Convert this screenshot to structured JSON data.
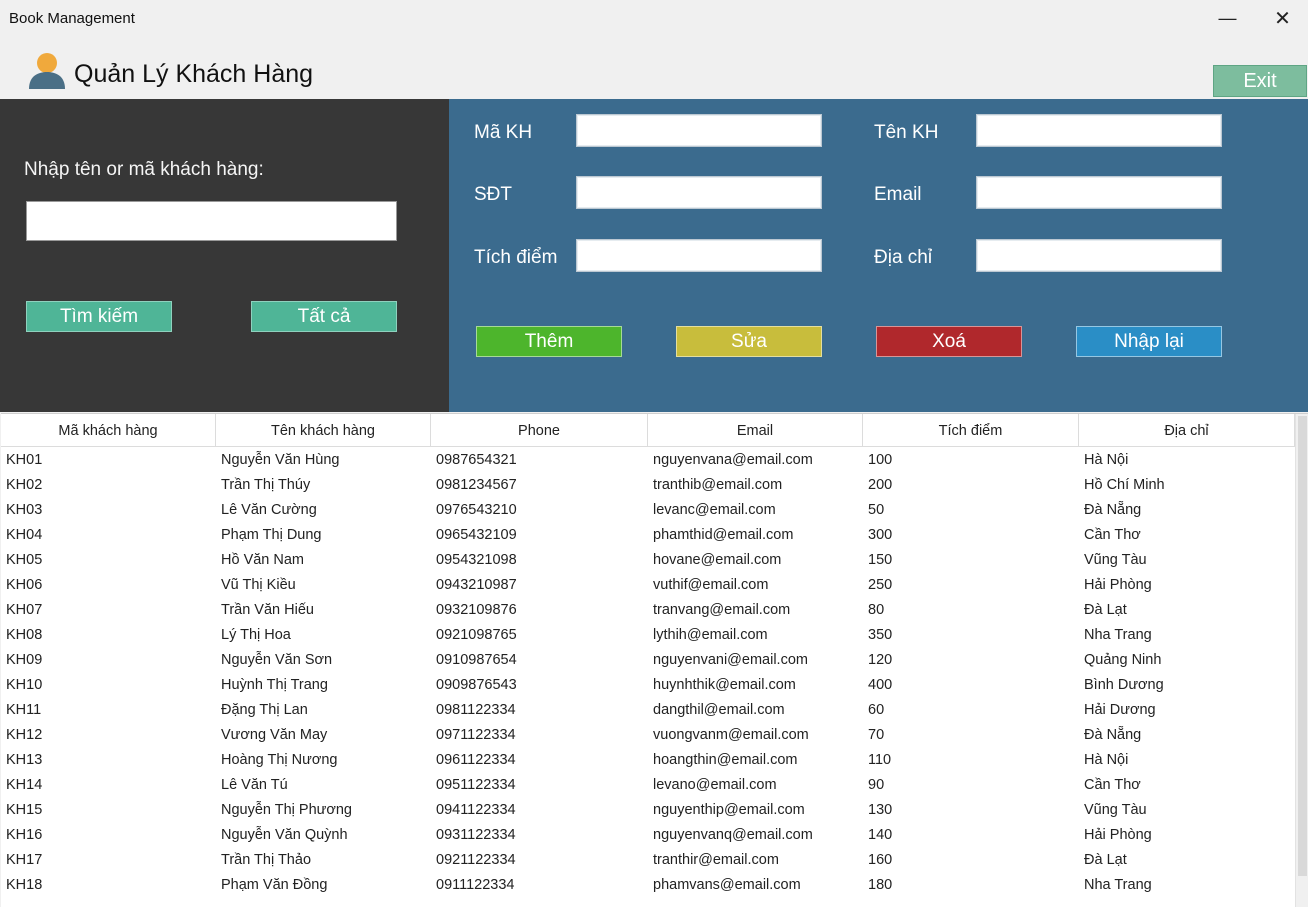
{
  "window": {
    "title": "Book Management",
    "minimize_glyph": "—",
    "close_glyph": "✕"
  },
  "header": {
    "title": "Quản Lý Khách Hàng",
    "icon": "user-icon",
    "exit_label": "Exit"
  },
  "search": {
    "label": "Nhập tên or mã khách hàng:",
    "value": "",
    "search_button": "Tìm kiếm",
    "all_button": "Tất cả"
  },
  "form": {
    "ma_kh_label": "Mã KH",
    "ten_kh_label": "Tên KH",
    "sdt_label": "SĐT",
    "email_label": "Email",
    "tich_diem_label": "Tích điểm",
    "dia_chi_label": "Địa chỉ",
    "ma_kh_value": "",
    "ten_kh_value": "",
    "sdt_value": "",
    "email_value": "",
    "tich_diem_value": "",
    "dia_chi_value": ""
  },
  "actions": {
    "add": "Thêm",
    "edit": "Sửa",
    "delete": "Xoá",
    "reset": "Nhập lại"
  },
  "colors": {
    "left_panel": "#373737",
    "right_panel": "#3b6b8e",
    "green_button": "#4fb597",
    "add": "#4db52c",
    "edit": "#c8bd3c",
    "delete": "#b0282c",
    "reset": "#2a8ec6",
    "exit": "#7dbd9e"
  },
  "table": {
    "columns": [
      "Mã khách hàng",
      "Tên khách hàng",
      "Phone",
      "Email",
      "Tích điểm",
      "Địa chỉ"
    ],
    "rows": [
      [
        "KH01",
        "Nguyễn Văn Hùng",
        "0987654321",
        "nguyenvana@email.com",
        "100",
        "Hà Nội"
      ],
      [
        "KH02",
        "Trần Thị Thúy",
        "0981234567",
        "tranthib@email.com",
        "200",
        "Hồ Chí Minh"
      ],
      [
        "KH03",
        "Lê Văn Cường",
        "0976543210",
        "levanc@email.com",
        "50",
        "Đà Nẵng"
      ],
      [
        "KH04",
        "Phạm Thị Dung",
        "0965432109",
        "phamthid@email.com",
        "300",
        "Cần Thơ"
      ],
      [
        "KH05",
        "Hồ Văn Nam",
        "0954321098",
        "hovane@email.com",
        "150",
        "Vũng Tàu"
      ],
      [
        "KH06",
        "Vũ Thị Kiều",
        "0943210987",
        "vuthif@email.com",
        "250",
        "Hải Phòng"
      ],
      [
        "KH07",
        "Trần Văn Hiếu",
        "0932109876",
        "tranvang@email.com",
        "80",
        "Đà Lạt"
      ],
      [
        "KH08",
        "Lý Thị Hoa",
        "0921098765",
        "lythih@email.com",
        "350",
        "Nha Trang"
      ],
      [
        "KH09",
        "Nguyễn Văn Sơn",
        "0910987654",
        "nguyenvani@email.com",
        "120",
        "Quảng Ninh"
      ],
      [
        "KH10",
        "Huỳnh Thị Trang",
        "0909876543",
        "huynhthik@email.com",
        "400",
        "Bình Dương"
      ],
      [
        "KH11",
        "Đặng Thị Lan",
        "0981122334",
        "dangthil@email.com",
        "60",
        "Hải Dương"
      ],
      [
        "KH12",
        "Vương Văn May",
        "0971122334",
        "vuongvanm@email.com",
        "70",
        "Đà Nẵng"
      ],
      [
        "KH13",
        "Hoàng Thị Nương",
        "0961122334",
        "hoangthin@email.com",
        "110",
        "Hà Nội"
      ],
      [
        "KH14",
        "Lê Văn Tú",
        "0951122334",
        "levano@email.com",
        "90",
        "Cần Thơ"
      ],
      [
        "KH15",
        "Nguyễn Thị Phương",
        "0941122334",
        "nguyenthip@email.com",
        "130",
        "Vũng Tàu"
      ],
      [
        "KH16",
        "Nguyễn Văn Quỳnh",
        "0931122334",
        "nguyenvanq@email.com",
        "140",
        "Hải Phòng"
      ],
      [
        "KH17",
        "Trần Thị Thảo",
        "0921122334",
        "tranthir@email.com",
        "160",
        "Đà Lạt"
      ],
      [
        "KH18",
        "Phạm Văn Đồng",
        "0911122334",
        "phamvans@email.com",
        "180",
        "Nha Trang"
      ]
    ]
  }
}
